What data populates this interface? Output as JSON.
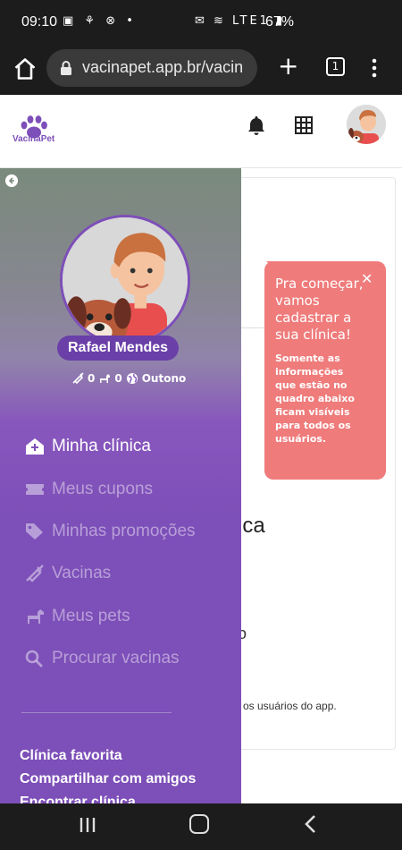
{
  "status_bar": {
    "time": "09:10",
    "left_icons": "▣ ⚘ ⊗ •",
    "right_icons": "✉ ≋ LTE1 ▮",
    "battery": "67%"
  },
  "browser": {
    "url": "vacinapet.app.br/vacin",
    "tab_count": "1"
  },
  "app": {
    "logo_text": "VacinaPet",
    "accent_color": "#7d4fb8"
  },
  "drawer": {
    "user_name": "Rafael Mendes",
    "stats": {
      "vaccines": "0",
      "pets": "0",
      "season": "Outono"
    },
    "menu": [
      {
        "label": "Minha clínica",
        "icon": "clinic-icon",
        "active": true
      },
      {
        "label": "Meus cupons",
        "icon": "coupon-icon",
        "active": false
      },
      {
        "label": "Minhas promoções",
        "icon": "tag-icon",
        "active": false
      },
      {
        "label": "Vacinas",
        "icon": "syringe-icon",
        "active": false
      },
      {
        "label": "Meus pets",
        "icon": "dog-icon",
        "active": false
      },
      {
        "label": "Procurar vacinas",
        "icon": "search-icon",
        "active": false
      }
    ],
    "footer_links": [
      "Clínica favorita",
      "Compartilhar com amigos",
      "Encontrar clínica"
    ]
  },
  "tooltip": {
    "heading": "Pra começar, vamos cadastrar a sua clínica!",
    "body": "Somente as informações que estão no quadro abaixo ficam visíveis para todos os usuários."
  },
  "background": {
    "title_fragment": "ica",
    "letter_fragment": "o",
    "desc_fragment": "os usuários do app."
  }
}
